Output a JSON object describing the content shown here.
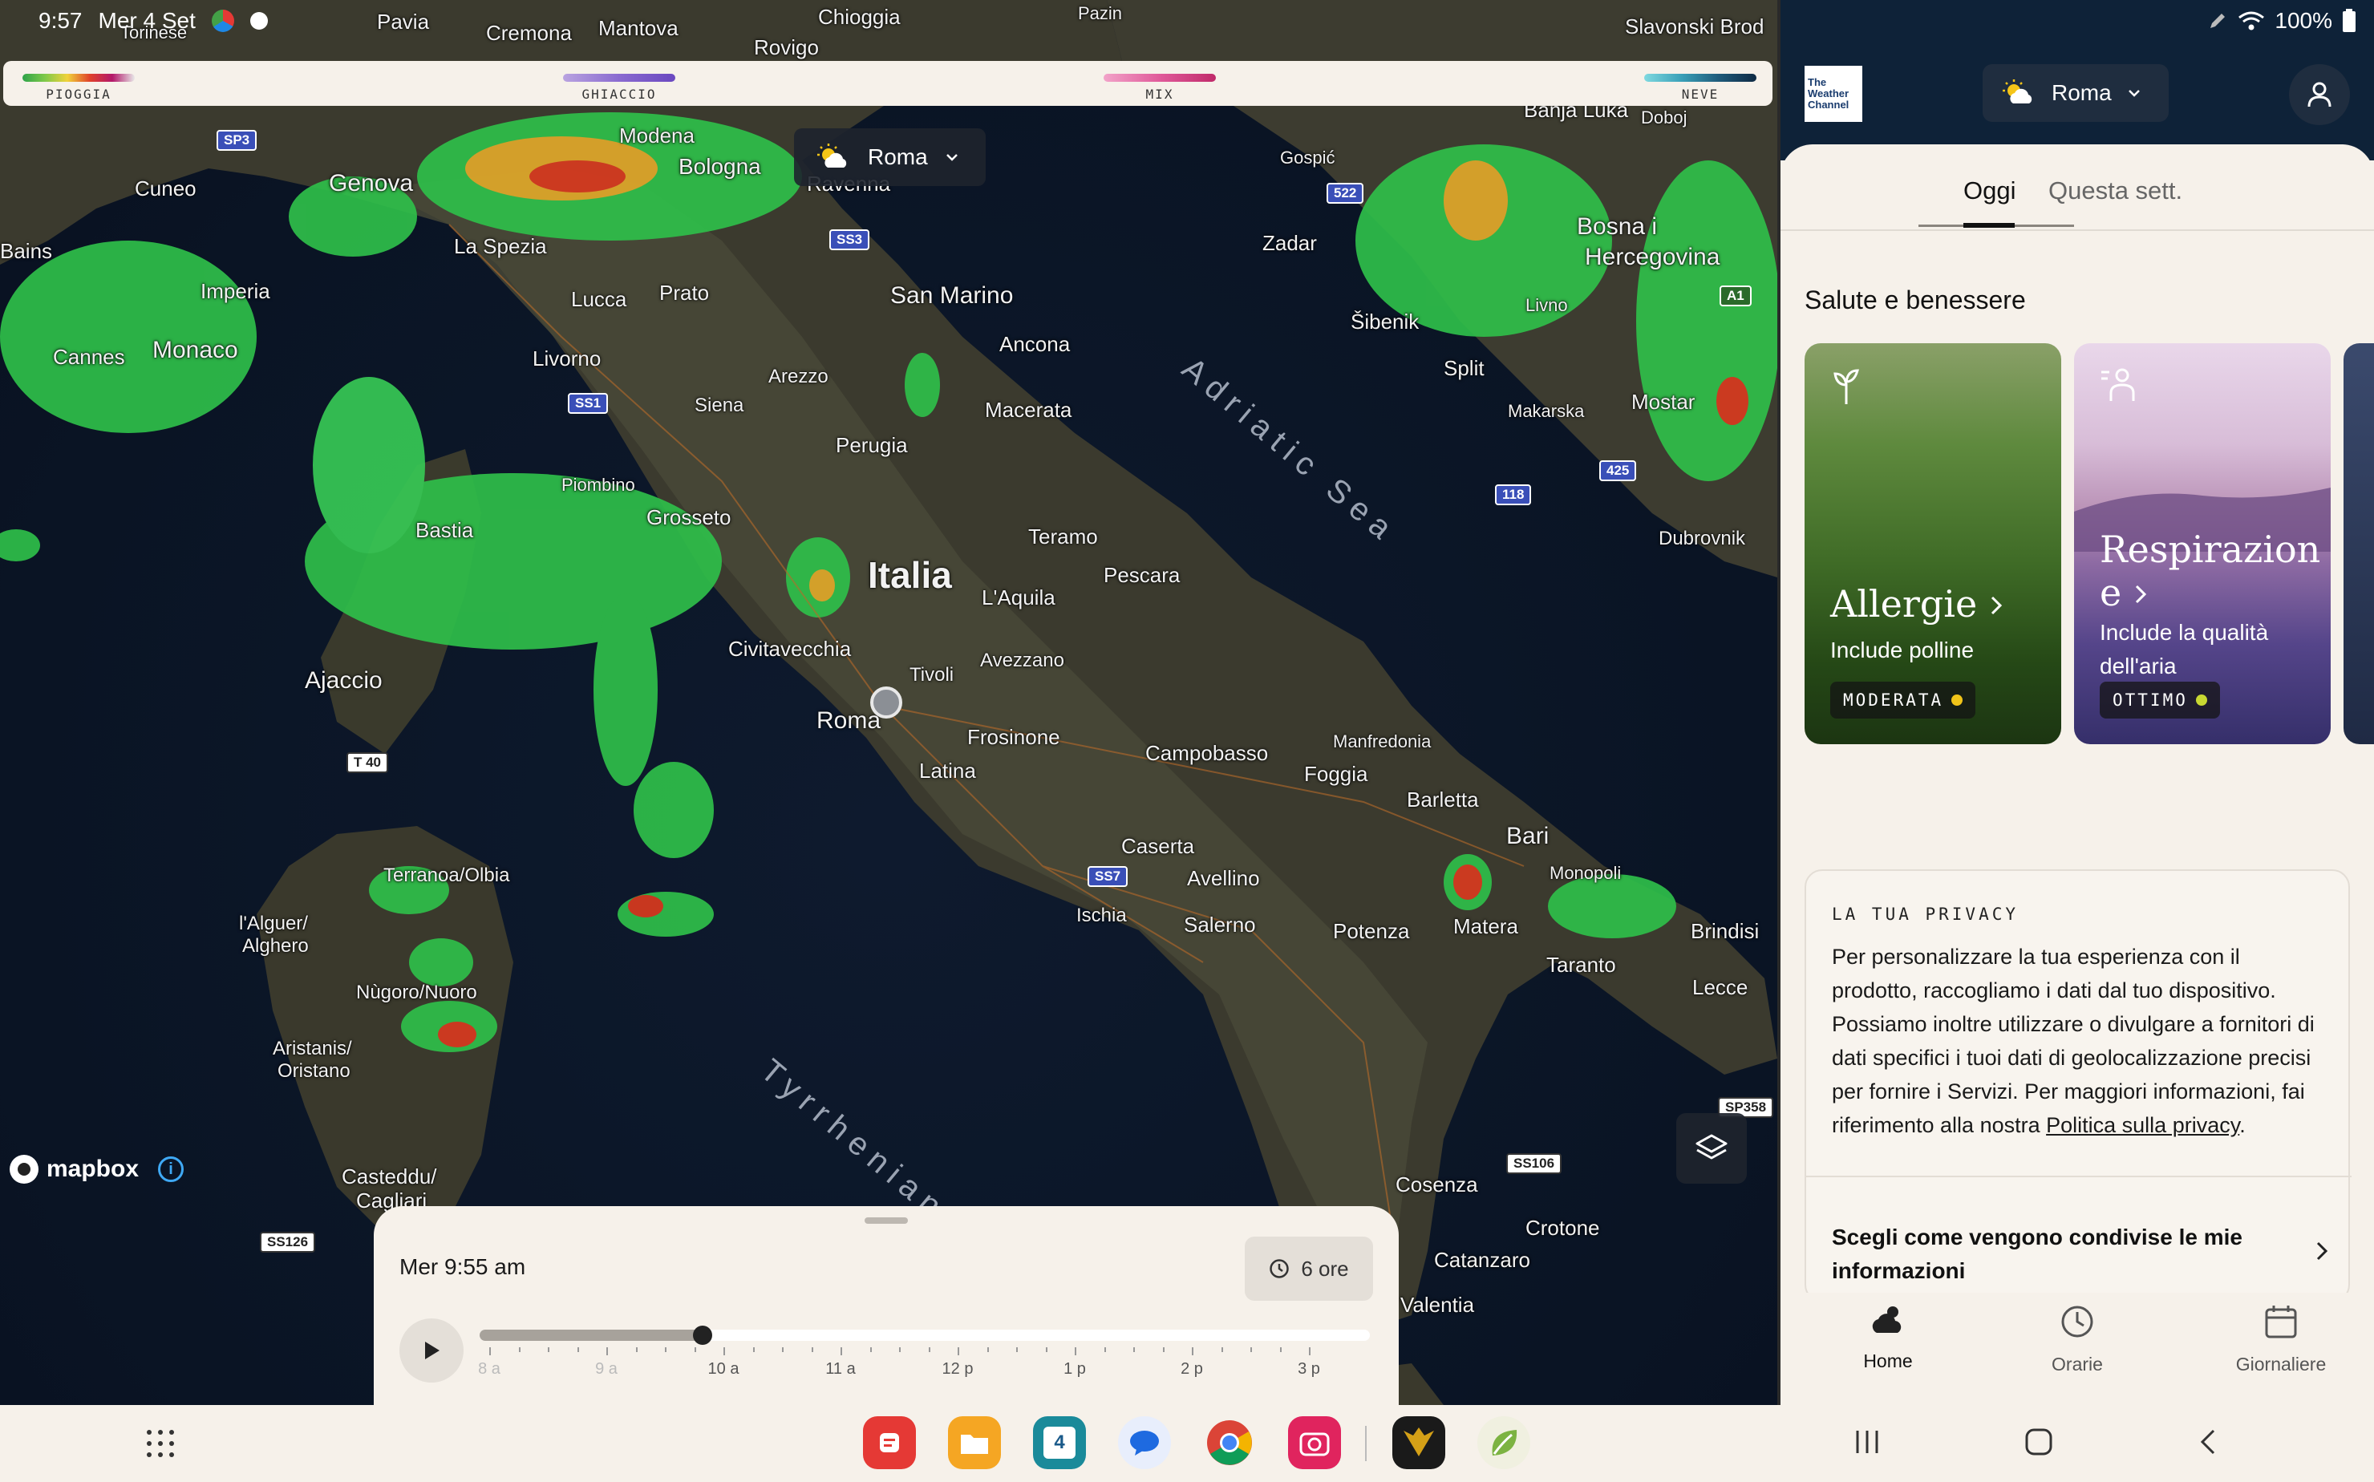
{
  "status": {
    "time": "9:57",
    "date": "Mer 4 Set",
    "battery": "100%"
  },
  "map": {
    "legend": [
      {
        "label": "PIOGGIA",
        "gradient": "linear-gradient(90deg,#2ea34a,#7fc94a,#f0d23a,#e0412b,#b3186a,#e8e8e8)"
      },
      {
        "label": "GHIACCIO",
        "gradient": "linear-gradient(90deg,#b9a3e0,#8a6ad0,#6a48c0)"
      },
      {
        "label": "MIX",
        "gradient": "linear-gradient(90deg,#f2a3c9,#e05a9a,#c02a6a)"
      },
      {
        "label": "NEVE",
        "gradient": "linear-gradient(90deg,#7fd9e0,#3aa0b8,#1f5a7a,#0f2a44)"
      }
    ],
    "location_label": "Roma",
    "labels": {
      "pavia": "Pavia",
      "cremona": "Cremona",
      "mantova": "Mantova",
      "chioggia": "Chioggia",
      "rovigo": "Rovigo",
      "pazin": "Pazin",
      "torinese": "Torinese",
      "slavonski": "Slavonski Brod",
      "banja": "Banja Luka",
      "doboj": "Doboj",
      "modena": "Modena",
      "bologna": "Bologna",
      "ravenna": "Ravenna",
      "gospic": "Gospić",
      "cuneo": "Cuneo",
      "genova": "Genova",
      "laspezia": "La Spezia",
      "imperia": "Imperia",
      "bains": "Bains",
      "cannes": "Cannes",
      "monaco": "Monaco",
      "lucca": "Lucca",
      "prato": "Prato",
      "sanmarino": "San Marino",
      "ancona": "Ancona",
      "zadar": "Zadar",
      "sibenik": "Šibenik",
      "split": "Split",
      "livno": "Livno",
      "bosna": "Bosna i",
      "herceg": "Hercegovina",
      "makarska": "Makarska",
      "mostar": "Mostar",
      "livorno": "Livorno",
      "arezzo": "Arezzo",
      "siena": "Siena",
      "macerata": "Macerata",
      "perugia": "Perugia",
      "piombino": "Piombino",
      "grosseto": "Grosseto",
      "bastia": "Bastia",
      "teramo": "Teramo",
      "italia": "Italia",
      "pescara": "Pescara",
      "laquila": "L'Aquila",
      "dubrovnik": "Dubrovnik",
      "adriatic": "Adriatic Sea",
      "civitavecchia": "Civitavecchia",
      "avezzano": "Avezzano",
      "tivoli": "Tivoli",
      "ajaccio": "Ajaccio",
      "roma": "Roma",
      "frosinone": "Frosinone",
      "manfredonia": "Manfredonia",
      "latina": "Latina",
      "campobasso": "Campobasso",
      "foggia": "Foggia",
      "barletta": "Barletta",
      "bari": "Bari",
      "terranova": "Terranoa/Olbia",
      "caserta": "Caserta",
      "avellino": "Avellino",
      "monopoli": "Monopoli",
      "alguer": "l'Alguer/",
      "alghero": "Alghero",
      "ischia": "Ischia",
      "salerno": "Salerno",
      "potenza": "Potenza",
      "matera": "Matera",
      "brindisi": "Brindisi",
      "nuoro": "Nùgoro/Nuoro",
      "taranto": "Taranto",
      "lecce": "Lecce",
      "aristanis": "Aristanis/",
      "oristano": "Oristano",
      "tyrrhenian": "Tyrrhenian",
      "casteddu": "Casteddu/",
      "cagliari": "Cagliari",
      "cosenza": "Cosenza",
      "crotone": "Crotone",
      "catanzaro": "Catanzaro",
      "valentia": "Valentia"
    },
    "roads": {
      "sp3": "SP3",
      "ss3": "SS3",
      "ss1": "SS1",
      "e522": "522",
      "a1": "A1",
      "e118": "118",
      "e425": "425",
      "t40": "T 40",
      "ss7": "SS7",
      "ss106": "SS106",
      "ss126": "SS126",
      "sp358": "SP358"
    },
    "attribution": "mapbox"
  },
  "timeline": {
    "current_time": "Mer 9:55 am",
    "duration": "6 ore",
    "progress": 0.25,
    "ticks": [
      {
        "label": "8 a",
        "past": true
      },
      {
        "label": "9 a",
        "past": true
      },
      {
        "label": "10 a",
        "past": false
      },
      {
        "label": "11 a",
        "past": false
      },
      {
        "label": "12 p",
        "past": false
      },
      {
        "label": "1 p",
        "past": false
      },
      {
        "label": "2 p",
        "past": false
      },
      {
        "label": "3 p",
        "past": false
      }
    ]
  },
  "app": {
    "logo_lines": [
      "The",
      "Weather",
      "Channel"
    ],
    "location": "Roma",
    "tabs": {
      "today": "Oggi",
      "week": "Questa sett."
    },
    "health_title": "Salute e benessere",
    "cards": {
      "allergie": {
        "title": "Allergie",
        "subtitle": "Include polline",
        "badge": "MODERATA",
        "badge_color": "#f0c419"
      },
      "respirazione": {
        "title_line1": "Respirazion",
        "title_line2": "e",
        "subtitle_line1": "Include la qualità",
        "subtitle_line2": "dell'aria",
        "badge": "OTTIMO",
        "badge_color": "#c8d832"
      }
    },
    "privacy": {
      "title": "LA TUA PRIVACY",
      "text": "Per personalizzare la tua esperienza con il prodotto, raccogliamo i dati dal tuo dispositivo. Possiamo inoltre utilizzare o divulgare a fornitori di dati specifici i tuoi dati di geolocalizzazione precisi per fornire i Servizi. Per maggiori informazioni, fai riferimento alla nostra ",
      "link": "Politica sulla privacy",
      "text_end": ".",
      "share": "Scegli come vengono condivise le mie informazioni"
    },
    "nav": {
      "home": "Home",
      "hourly": "Orarie",
      "daily": "Giornaliere"
    }
  },
  "dock": {
    "calendar_day": "4"
  }
}
